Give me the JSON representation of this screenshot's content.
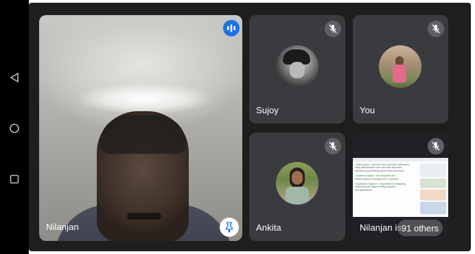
{
  "participants": {
    "main": {
      "name": "Nilanjan"
    },
    "tile1": {
      "name": "Sujoy"
    },
    "tile2": {
      "name": "You"
    },
    "tile3": {
      "name": "Ankita"
    },
    "tile4": {
      "name": "Nilanjan is"
    }
  },
  "others_chip": "91 others",
  "slide_text": [
    "• Data analyst : someone who scrutinizes information",
    "using data analysis tools and make important",
    "decisions by identifying various facts and trends.",
    "• System's analyst : use computers and",
    "related systems to design new IT solutions.",
    "• Application Engineer : responsible for designing,",
    "developing and implementing programs",
    "and applications."
  ],
  "icons": {
    "nav_back": "back-triangle-icon",
    "nav_home": "home-circle-icon",
    "nav_recent": "recent-square-icon",
    "mute": "mic-off-icon",
    "speaking": "audio-wave-icon",
    "pin": "pin-icon"
  },
  "colors": {
    "tile_bg": "#3a3b3f",
    "call_bg": "#1e1e1e",
    "speaking_accent": "#1a73e8",
    "mute_badge": "#5f6064"
  }
}
